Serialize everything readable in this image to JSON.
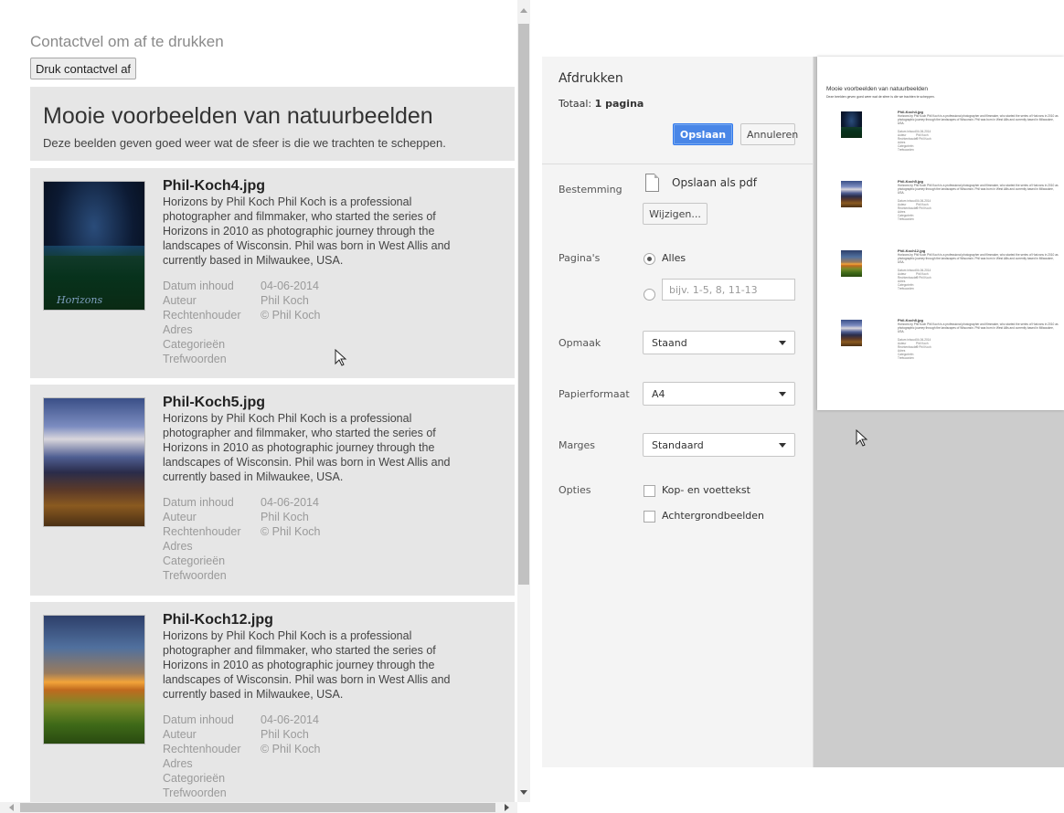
{
  "contact_sheet": {
    "title": "Contactvel om af te drukken",
    "print_button": "Druk contactvel af",
    "heading": "Mooie voorbeelden van natuurbeelden",
    "subheading": "Deze beelden geven goed weer wat de sfeer is die we trachten te scheppen.",
    "meta_labels": {
      "date": "Datum inhoud",
      "author": "Auteur",
      "copyright": "Rechtenhouder",
      "address": "Adres",
      "categories": "Categorieën",
      "keywords": "Trefwoorden"
    },
    "items": [
      {
        "filename": "Phil-Koch4.jpg",
        "thumbnail_text": "Horizons",
        "description": "Horizons by Phil Koch Phil Koch is a professional photographer and filmmaker, who started the series of Horizons in 2010 as photographic journey through the landscapes of Wisconsin. Phil was born in West Allis and currently based in Milwaukee, USA.",
        "date": "04-06-2014",
        "author": "Phil Koch",
        "copyright": "© Phil Koch"
      },
      {
        "filename": "Phil-Koch5.jpg",
        "description": "Horizons by Phil Koch Phil Koch is a professional photographer and filmmaker, who started the series of Horizons in 2010 as photographic journey through the landscapes of Wisconsin. Phil was born in West Allis and currently based in Milwaukee, USA.",
        "date": "04-06-2014",
        "author": "Phil Koch",
        "copyright": "© Phil Koch"
      },
      {
        "filename": "Phil-Koch12.jpg",
        "description": "Horizons by Phil Koch Phil Koch is a professional photographer and filmmaker, who started the series of Horizons in 2010 as photographic journey through the landscapes of Wisconsin. Phil was born in West Allis and currently based in Milwaukee, USA.",
        "date": "04-06-2014",
        "author": "Phil Koch",
        "copyright": "© Phil Koch"
      }
    ]
  },
  "print_dialog": {
    "title": "Afdrukken",
    "total_label": "Totaal:",
    "total_value": "1 pagina",
    "save_button": "Opslaan",
    "cancel_button": "Annuleren",
    "destination_label": "Bestemming",
    "destination_value": "Opslaan als pdf",
    "change_button": "Wijzigen...",
    "pages_label": "Pagina's",
    "pages_all": "Alles",
    "pages_placeholder": "bijv. 1-5, 8, 11-13",
    "layout_label": "Opmaak",
    "layout_value": "Staand",
    "paper_label": "Papierformaat",
    "paper_value": "A4",
    "margins_label": "Marges",
    "margins_value": "Standaard",
    "options_label": "Opties",
    "option_header_footer": "Kop- en voettekst",
    "option_background": "Achtergrondbeelden"
  },
  "preview": {
    "title": "Mooie voorbeelden van natuurbeelden",
    "subtitle": "Deze beelden geven goed weer wat de sfeer is die we trachten te scheppen.",
    "items": [
      {
        "filename": "Phil-Koch4.jpg"
      },
      {
        "filename": "Phil-Koch5.jpg"
      },
      {
        "filename": "Phil-Koch12.jpg"
      },
      {
        "filename": "Phil-Koch8.jpg"
      }
    ]
  },
  "colors": {
    "save_button": "#4986e7",
    "card_background": "#e6e6e6",
    "preview_background": "#cccccc"
  }
}
